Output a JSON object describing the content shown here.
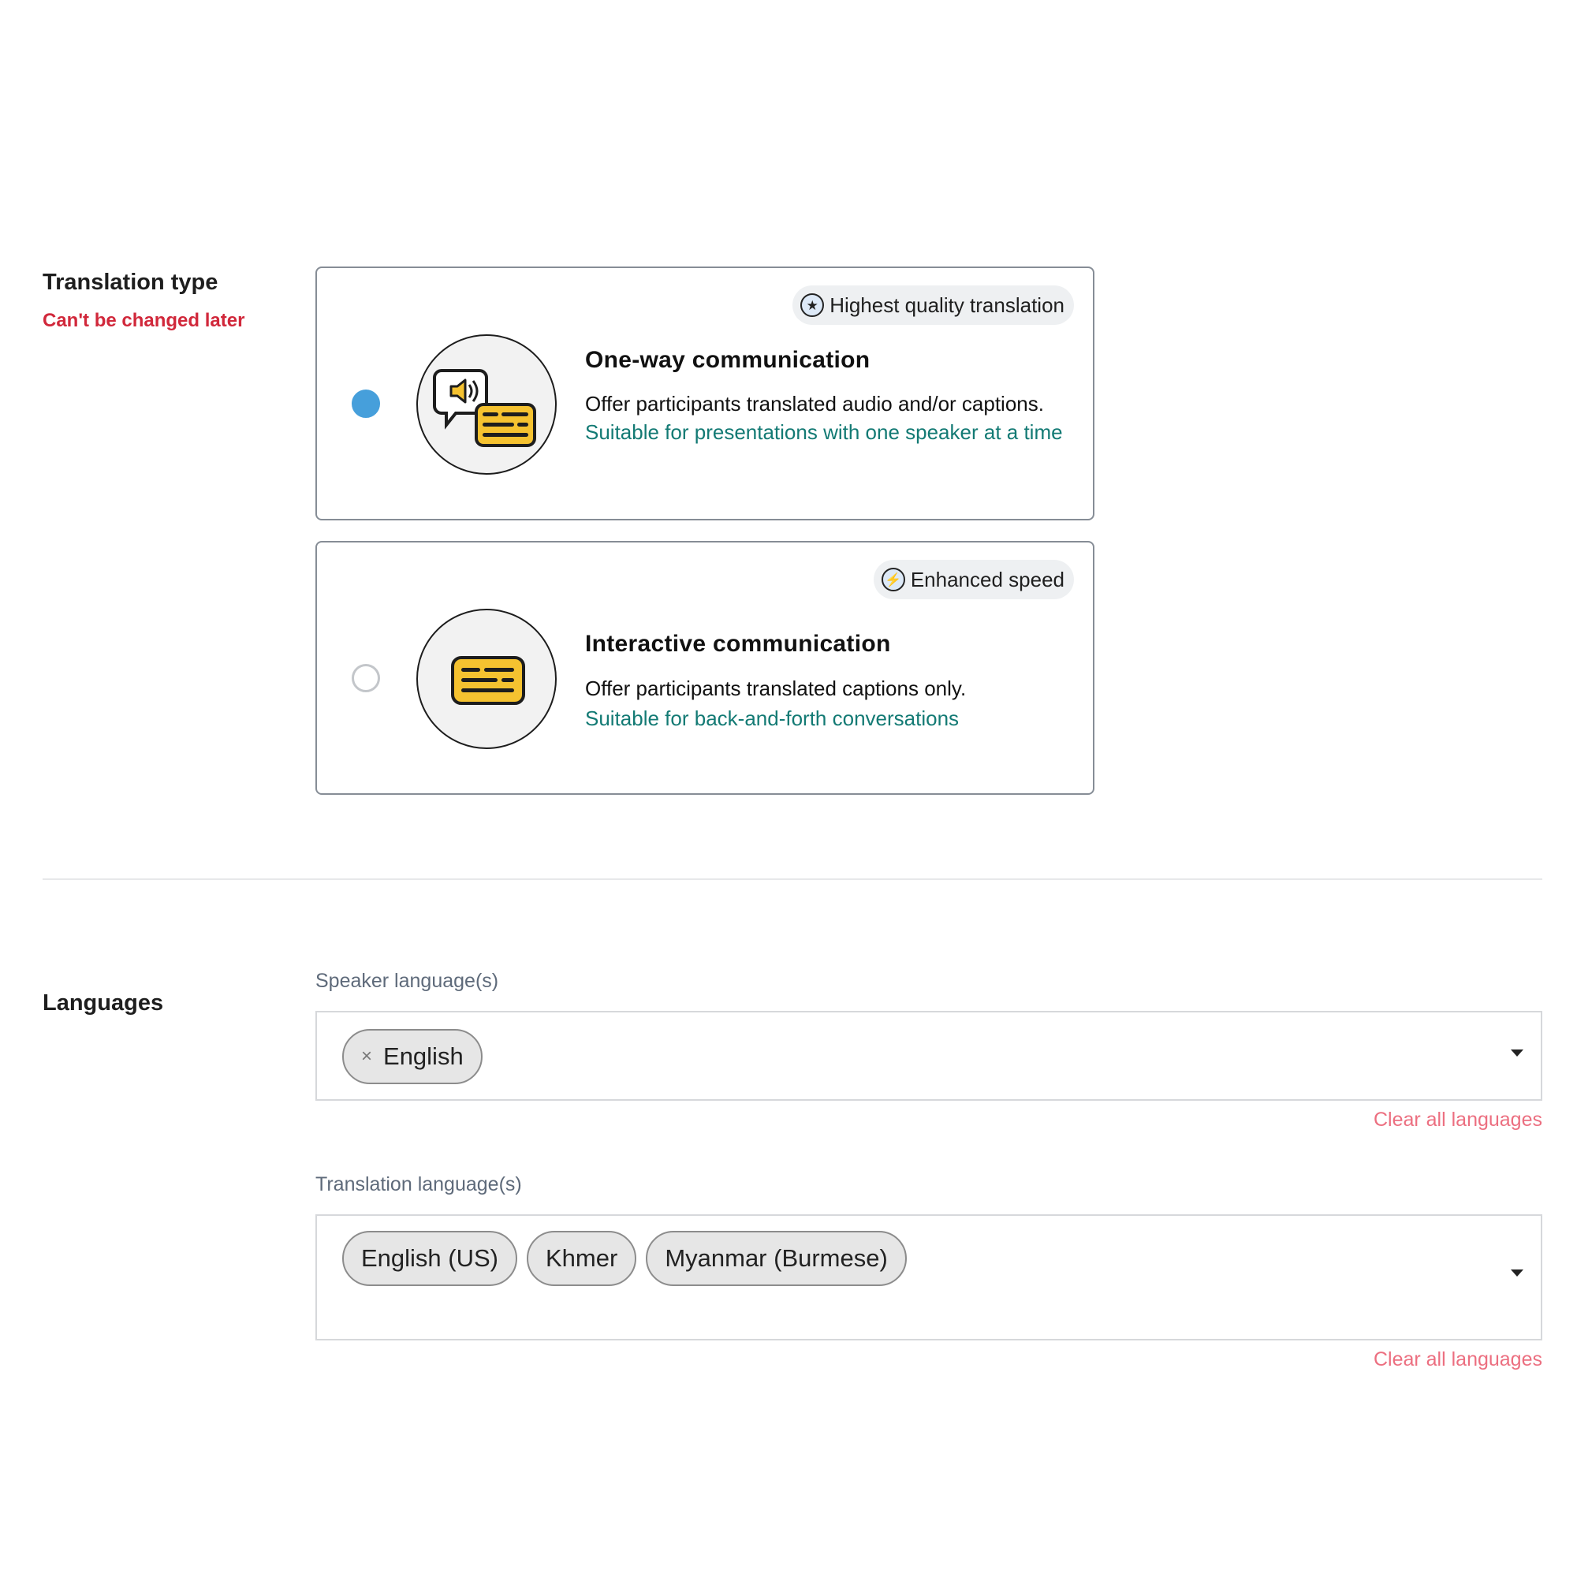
{
  "translation_type": {
    "title": "Translation type",
    "warning": "Can't be changed later",
    "options": [
      {
        "badge_icon": "star-icon",
        "badge": "Highest quality translation",
        "title": "One-way communication",
        "description": "Offer participants translated audio and/or captions.",
        "note": "Suitable for presentations with one speaker at a time",
        "selected": true
      },
      {
        "badge_icon": "lightning-icon",
        "badge": "Enhanced speed",
        "title": "Interactive communication",
        "description": "Offer participants translated captions only.",
        "note": "Suitable for back-and-forth conversations",
        "selected": false
      }
    ]
  },
  "languages": {
    "title": "Languages",
    "speaker": {
      "label": "Speaker language(s)",
      "chips": [
        "English"
      ],
      "remove_glyph": "×",
      "clear_label": "Clear all languages"
    },
    "translation": {
      "label": "Translation language(s)",
      "chips": [
        "English (US)",
        "Khmer",
        "Myanmar (Burmese)"
      ],
      "clear_label": "Clear all languages"
    }
  },
  "colors": {
    "selected_radio": "#469fdb",
    "warning": "#d1283b",
    "note_teal": "#137a74",
    "clear_link": "#ec6f80",
    "icon_yellow": "#f5c230"
  }
}
